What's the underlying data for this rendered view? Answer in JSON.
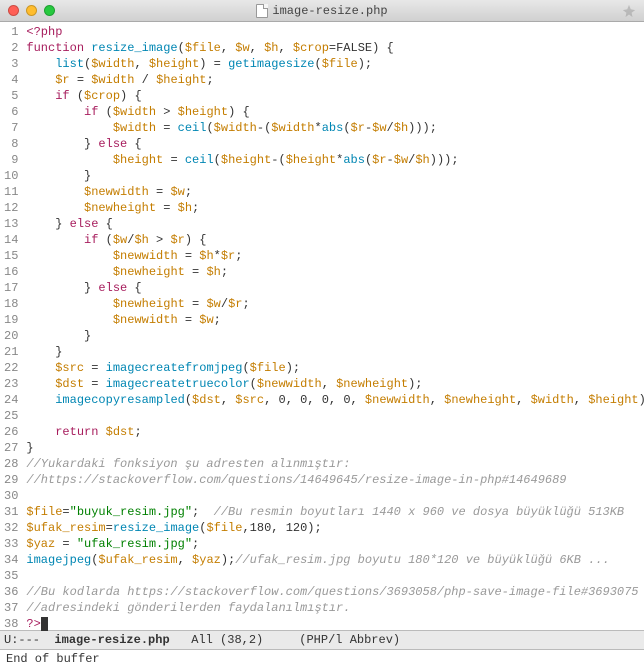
{
  "window": {
    "title": "image-resize.php"
  },
  "code": {
    "lines": [
      {
        "n": 1,
        "t": [
          [
            "kw",
            "<?php"
          ]
        ]
      },
      {
        "n": 2,
        "t": [
          [
            "kw",
            "function "
          ],
          [
            "fn",
            "resize_image"
          ],
          [
            "punc",
            "("
          ],
          [
            "var",
            "$file"
          ],
          [
            "punc",
            ", "
          ],
          [
            "var",
            "$w"
          ],
          [
            "punc",
            ", "
          ],
          [
            "var",
            "$h"
          ],
          [
            "punc",
            ", "
          ],
          [
            "var",
            "$crop"
          ],
          [
            "punc",
            "="
          ],
          [
            "bool",
            "FALSE"
          ],
          [
            "punc",
            ") {"
          ]
        ]
      },
      {
        "n": 3,
        "t": [
          [
            "punc",
            "    "
          ],
          [
            "fn",
            "list"
          ],
          [
            "punc",
            "("
          ],
          [
            "var",
            "$width"
          ],
          [
            "punc",
            ", "
          ],
          [
            "var",
            "$height"
          ],
          [
            "punc",
            ") = "
          ],
          [
            "fn",
            "getimagesize"
          ],
          [
            "punc",
            "("
          ],
          [
            "var",
            "$file"
          ],
          [
            "punc",
            ");"
          ]
        ]
      },
      {
        "n": 4,
        "t": [
          [
            "punc",
            "    "
          ],
          [
            "var",
            "$r"
          ],
          [
            "punc",
            " = "
          ],
          [
            "var",
            "$width"
          ],
          [
            "punc",
            " / "
          ],
          [
            "var",
            "$height"
          ],
          [
            "punc",
            ";"
          ]
        ]
      },
      {
        "n": 5,
        "t": [
          [
            "punc",
            "    "
          ],
          [
            "kw",
            "if"
          ],
          [
            "punc",
            " ("
          ],
          [
            "var",
            "$crop"
          ],
          [
            "punc",
            ") {"
          ]
        ]
      },
      {
        "n": 6,
        "t": [
          [
            "punc",
            "        "
          ],
          [
            "kw",
            "if"
          ],
          [
            "punc",
            " ("
          ],
          [
            "var",
            "$width"
          ],
          [
            "punc",
            " > "
          ],
          [
            "var",
            "$height"
          ],
          [
            "punc",
            ") {"
          ]
        ]
      },
      {
        "n": 7,
        "t": [
          [
            "punc",
            "            "
          ],
          [
            "var",
            "$width"
          ],
          [
            "punc",
            " = "
          ],
          [
            "fn",
            "ceil"
          ],
          [
            "punc",
            "("
          ],
          [
            "var",
            "$width"
          ],
          [
            "punc",
            "-("
          ],
          [
            "var",
            "$width"
          ],
          [
            "punc",
            "*"
          ],
          [
            "fn",
            "abs"
          ],
          [
            "punc",
            "("
          ],
          [
            "var",
            "$r"
          ],
          [
            "punc",
            "-"
          ],
          [
            "var",
            "$w"
          ],
          [
            "punc",
            "/"
          ],
          [
            "var",
            "$h"
          ],
          [
            "punc",
            ")));"
          ]
        ]
      },
      {
        "n": 8,
        "t": [
          [
            "punc",
            "        } "
          ],
          [
            "kw",
            "else"
          ],
          [
            "punc",
            " {"
          ]
        ]
      },
      {
        "n": 9,
        "t": [
          [
            "punc",
            "            "
          ],
          [
            "var",
            "$height"
          ],
          [
            "punc",
            " = "
          ],
          [
            "fn",
            "ceil"
          ],
          [
            "punc",
            "("
          ],
          [
            "var",
            "$height"
          ],
          [
            "punc",
            "-("
          ],
          [
            "var",
            "$height"
          ],
          [
            "punc",
            "*"
          ],
          [
            "fn",
            "abs"
          ],
          [
            "punc",
            "("
          ],
          [
            "var",
            "$r"
          ],
          [
            "punc",
            "-"
          ],
          [
            "var",
            "$w"
          ],
          [
            "punc",
            "/"
          ],
          [
            "var",
            "$h"
          ],
          [
            "punc",
            ")));"
          ]
        ]
      },
      {
        "n": 10,
        "t": [
          [
            "punc",
            "        }"
          ]
        ]
      },
      {
        "n": 11,
        "t": [
          [
            "punc",
            "        "
          ],
          [
            "var",
            "$newwidth"
          ],
          [
            "punc",
            " = "
          ],
          [
            "var",
            "$w"
          ],
          [
            "punc",
            ";"
          ]
        ]
      },
      {
        "n": 12,
        "t": [
          [
            "punc",
            "        "
          ],
          [
            "var",
            "$newheight"
          ],
          [
            "punc",
            " = "
          ],
          [
            "var",
            "$h"
          ],
          [
            "punc",
            ";"
          ]
        ]
      },
      {
        "n": 13,
        "t": [
          [
            "punc",
            "    } "
          ],
          [
            "kw",
            "else"
          ],
          [
            "punc",
            " {"
          ]
        ]
      },
      {
        "n": 14,
        "t": [
          [
            "punc",
            "        "
          ],
          [
            "kw",
            "if"
          ],
          [
            "punc",
            " ("
          ],
          [
            "var",
            "$w"
          ],
          [
            "punc",
            "/"
          ],
          [
            "var",
            "$h"
          ],
          [
            "punc",
            " > "
          ],
          [
            "var",
            "$r"
          ],
          [
            "punc",
            ") {"
          ]
        ]
      },
      {
        "n": 15,
        "t": [
          [
            "punc",
            "            "
          ],
          [
            "var",
            "$newwidth"
          ],
          [
            "punc",
            " = "
          ],
          [
            "var",
            "$h"
          ],
          [
            "punc",
            "*"
          ],
          [
            "var",
            "$r"
          ],
          [
            "punc",
            ";"
          ]
        ]
      },
      {
        "n": 16,
        "t": [
          [
            "punc",
            "            "
          ],
          [
            "var",
            "$newheight"
          ],
          [
            "punc",
            " = "
          ],
          [
            "var",
            "$h"
          ],
          [
            "punc",
            ";"
          ]
        ]
      },
      {
        "n": 17,
        "t": [
          [
            "punc",
            "        } "
          ],
          [
            "kw",
            "else"
          ],
          [
            "punc",
            " {"
          ]
        ]
      },
      {
        "n": 18,
        "t": [
          [
            "punc",
            "            "
          ],
          [
            "var",
            "$newheight"
          ],
          [
            "punc",
            " = "
          ],
          [
            "var",
            "$w"
          ],
          [
            "punc",
            "/"
          ],
          [
            "var",
            "$r"
          ],
          [
            "punc",
            ";"
          ]
        ]
      },
      {
        "n": 19,
        "t": [
          [
            "punc",
            "            "
          ],
          [
            "var",
            "$newwidth"
          ],
          [
            "punc",
            " = "
          ],
          [
            "var",
            "$w"
          ],
          [
            "punc",
            ";"
          ]
        ]
      },
      {
        "n": 20,
        "t": [
          [
            "punc",
            "        }"
          ]
        ]
      },
      {
        "n": 21,
        "t": [
          [
            "punc",
            "    }"
          ]
        ]
      },
      {
        "n": 22,
        "t": [
          [
            "punc",
            "    "
          ],
          [
            "var",
            "$src"
          ],
          [
            "punc",
            " = "
          ],
          [
            "fn",
            "imagecreatefromjpeg"
          ],
          [
            "punc",
            "("
          ],
          [
            "var",
            "$file"
          ],
          [
            "punc",
            ");"
          ]
        ]
      },
      {
        "n": 23,
        "t": [
          [
            "punc",
            "    "
          ],
          [
            "var",
            "$dst"
          ],
          [
            "punc",
            " = "
          ],
          [
            "fn",
            "imagecreatetruecolor"
          ],
          [
            "punc",
            "("
          ],
          [
            "var",
            "$newwidth"
          ],
          [
            "punc",
            ", "
          ],
          [
            "var",
            "$newheight"
          ],
          [
            "punc",
            ");"
          ]
        ]
      },
      {
        "n": 24,
        "t": [
          [
            "punc",
            "    "
          ],
          [
            "fn",
            "imagecopyresampled"
          ],
          [
            "punc",
            "("
          ],
          [
            "var",
            "$dst"
          ],
          [
            "punc",
            ", "
          ],
          [
            "var",
            "$src"
          ],
          [
            "punc",
            ", "
          ],
          [
            "num",
            "0"
          ],
          [
            "punc",
            ", "
          ],
          [
            "num",
            "0"
          ],
          [
            "punc",
            ", "
          ],
          [
            "num",
            "0"
          ],
          [
            "punc",
            ", "
          ],
          [
            "num",
            "0"
          ],
          [
            "punc",
            ", "
          ],
          [
            "var",
            "$newwidth"
          ],
          [
            "punc",
            ", "
          ],
          [
            "var",
            "$newheight"
          ],
          [
            "punc",
            ", "
          ],
          [
            "var",
            "$width"
          ],
          [
            "punc",
            ", "
          ],
          [
            "var",
            "$height"
          ],
          [
            "punc",
            ");"
          ]
        ]
      },
      {
        "n": 25,
        "t": [
          [
            "punc",
            ""
          ]
        ]
      },
      {
        "n": 26,
        "t": [
          [
            "punc",
            "    "
          ],
          [
            "kw",
            "return"
          ],
          [
            "punc",
            " "
          ],
          [
            "var",
            "$dst"
          ],
          [
            "punc",
            ";"
          ]
        ]
      },
      {
        "n": 27,
        "t": [
          [
            "punc",
            "}"
          ]
        ]
      },
      {
        "n": 28,
        "t": [
          [
            "cmt",
            "//Yukardaki fonksiyon şu adresten alınmıştır:"
          ]
        ]
      },
      {
        "n": 29,
        "t": [
          [
            "cmt",
            "//https://stackoverflow.com/questions/14649645/resize-image-in-php#14649689"
          ]
        ]
      },
      {
        "n": 30,
        "t": [
          [
            "punc",
            ""
          ]
        ]
      },
      {
        "n": 31,
        "t": [
          [
            "var",
            "$file"
          ],
          [
            "punc",
            "="
          ],
          [
            "str",
            "\"buyuk_resim.jpg\""
          ],
          [
            "punc",
            ";  "
          ],
          [
            "cmt",
            "//Bu resmin boyutları 1440 x 960 ve dosya büyüklüğü 513KB"
          ]
        ]
      },
      {
        "n": 32,
        "t": [
          [
            "var",
            "$ufak_resim"
          ],
          [
            "punc",
            "="
          ],
          [
            "fn",
            "resize_image"
          ],
          [
            "punc",
            "("
          ],
          [
            "var",
            "$file"
          ],
          [
            "punc",
            ","
          ],
          [
            "num",
            "180"
          ],
          [
            "punc",
            ", "
          ],
          [
            "num",
            "120"
          ],
          [
            "punc",
            ");"
          ]
        ]
      },
      {
        "n": 33,
        "t": [
          [
            "var",
            "$yaz"
          ],
          [
            "punc",
            " = "
          ],
          [
            "str",
            "\"ufak_resim.jpg\""
          ],
          [
            "punc",
            ";"
          ]
        ]
      },
      {
        "n": 34,
        "t": [
          [
            "fn",
            "imagejpeg"
          ],
          [
            "punc",
            "("
          ],
          [
            "var",
            "$ufak_resim"
          ],
          [
            "punc",
            ", "
          ],
          [
            "var",
            "$yaz"
          ],
          [
            "punc",
            ");"
          ],
          [
            "cmt",
            "//ufak_resim.jpg boyutu 180*120 ve büyüklüğü 6KB ..."
          ]
        ]
      },
      {
        "n": 35,
        "t": [
          [
            "punc",
            ""
          ]
        ]
      },
      {
        "n": 36,
        "t": [
          [
            "cmt",
            "//Bu kodlarda https://stackoverflow.com/questions/3693058/php-save-image-file#3693075"
          ]
        ]
      },
      {
        "n": 37,
        "t": [
          [
            "cmt",
            "//adresindeki gönderilerden faydalanılmıştır."
          ]
        ]
      },
      {
        "n": 38,
        "t": [
          [
            "kw",
            "?>"
          ],
          [
            "cursor",
            ""
          ]
        ]
      }
    ]
  },
  "modeline": {
    "status": "U:---",
    "file": "image-resize.php",
    "position": "All (38,2)",
    "modes": "(PHP/l Abbrev)"
  },
  "minibuffer": {
    "text": "End of buffer"
  }
}
